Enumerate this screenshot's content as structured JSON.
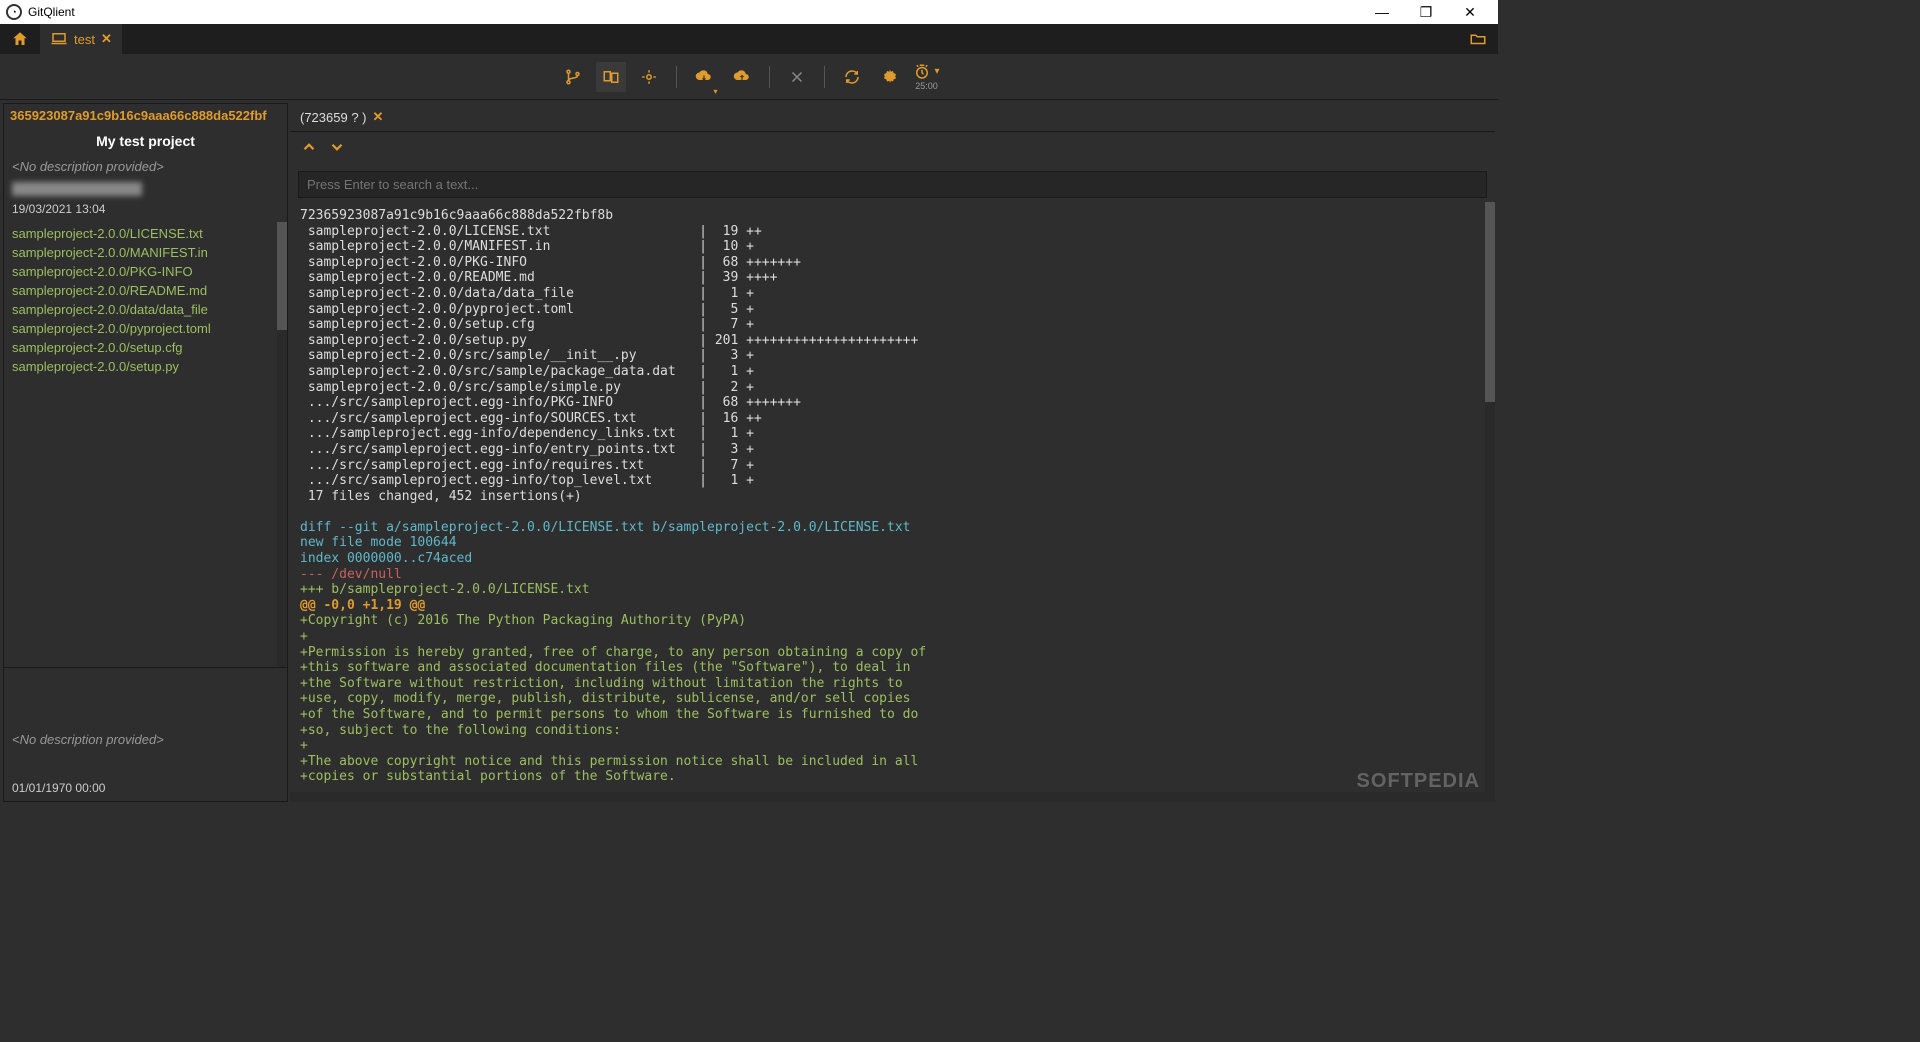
{
  "window": {
    "title": "GitQlient"
  },
  "tabs": {
    "test": "test"
  },
  "toolbar": {
    "pomodoro": "25:00"
  },
  "sidebar": {
    "commit_hash": "365923087a91c9b16c9aaa66c888da522fbf",
    "project_name": "My test project",
    "description": "<No description provided>",
    "date": "19/03/2021 13:04",
    "files": [
      "sampleproject-2.0.0/LICENSE.txt",
      "sampleproject-2.0.0/MANIFEST.in",
      "sampleproject-2.0.0/PKG-INFO",
      "sampleproject-2.0.0/README.md",
      "sampleproject-2.0.0/data/data_file",
      "sampleproject-2.0.0/pyproject.toml",
      "sampleproject-2.0.0/setup.cfg",
      "sampleproject-2.0.0/setup.py"
    ],
    "bottom_desc": "<No description provided>",
    "bottom_date": "01/01/1970 00:00"
  },
  "subtab": {
    "label": "(723659 ? )"
  },
  "search": {
    "placeholder": "Press Enter to search a text..."
  },
  "diff": {
    "hash": "72365923087a91c9b16c9aaa66c888da522fbf8b",
    "stats": [
      " sampleproject-2.0.0/LICENSE.txt                   |  19 ++",
      " sampleproject-2.0.0/MANIFEST.in                   |  10 +",
      " sampleproject-2.0.0/PKG-INFO                      |  68 +++++++",
      " sampleproject-2.0.0/README.md                     |  39 ++++",
      " sampleproject-2.0.0/data/data_file                |   1 +",
      " sampleproject-2.0.0/pyproject.toml                |   5 +",
      " sampleproject-2.0.0/setup.cfg                     |   7 +",
      " sampleproject-2.0.0/setup.py                      | 201 ++++++++++++++++++++++",
      " sampleproject-2.0.0/src/sample/__init__.py        |   3 +",
      " sampleproject-2.0.0/src/sample/package_data.dat   |   1 +",
      " sampleproject-2.0.0/src/sample/simple.py          |   2 +",
      " .../src/sampleproject.egg-info/PKG-INFO           |  68 +++++++",
      " .../src/sampleproject.egg-info/SOURCES.txt        |  16 ++",
      " .../sampleproject.egg-info/dependency_links.txt   |   1 +",
      " .../src/sampleproject.egg-info/entry_points.txt   |   3 +",
      " .../src/sampleproject.egg-info/requires.txt       |   7 +",
      " .../src/sampleproject.egg-info/top_level.txt      |   1 +",
      " 17 files changed, 452 insertions(+)"
    ],
    "header": [
      {
        "c": "c-cyan",
        "t": "diff --git a/sampleproject-2.0.0/LICENSE.txt b/sampleproject-2.0.0/LICENSE.txt"
      },
      {
        "c": "c-cyan",
        "t": "new file mode 100644"
      },
      {
        "c": "c-cyan",
        "t": "index 0000000..c74aced"
      },
      {
        "c": "c-red",
        "t": "--- /dev/null"
      },
      {
        "c": "c-green",
        "t": "+++ b/sampleproject-2.0.0/LICENSE.txt"
      },
      {
        "c": "c-orange",
        "t": "@@ -0,0 +1,19 @@"
      }
    ],
    "added": [
      "+Copyright (c) 2016 The Python Packaging Authority (PyPA)",
      "+",
      "+Permission is hereby granted, free of charge, to any person obtaining a copy of",
      "+this software and associated documentation files (the \"Software\"), to deal in",
      "+the Software without restriction, including without limitation the rights to",
      "+use, copy, modify, merge, publish, distribute, sublicense, and/or sell copies",
      "+of the Software, and to permit persons to whom the Software is furnished to do",
      "+so, subject to the following conditions:",
      "+",
      "+The above copyright notice and this permission notice shall be included in all",
      "+copies or substantial portions of the Software."
    ]
  },
  "watermark": "SOFTPEDIA"
}
